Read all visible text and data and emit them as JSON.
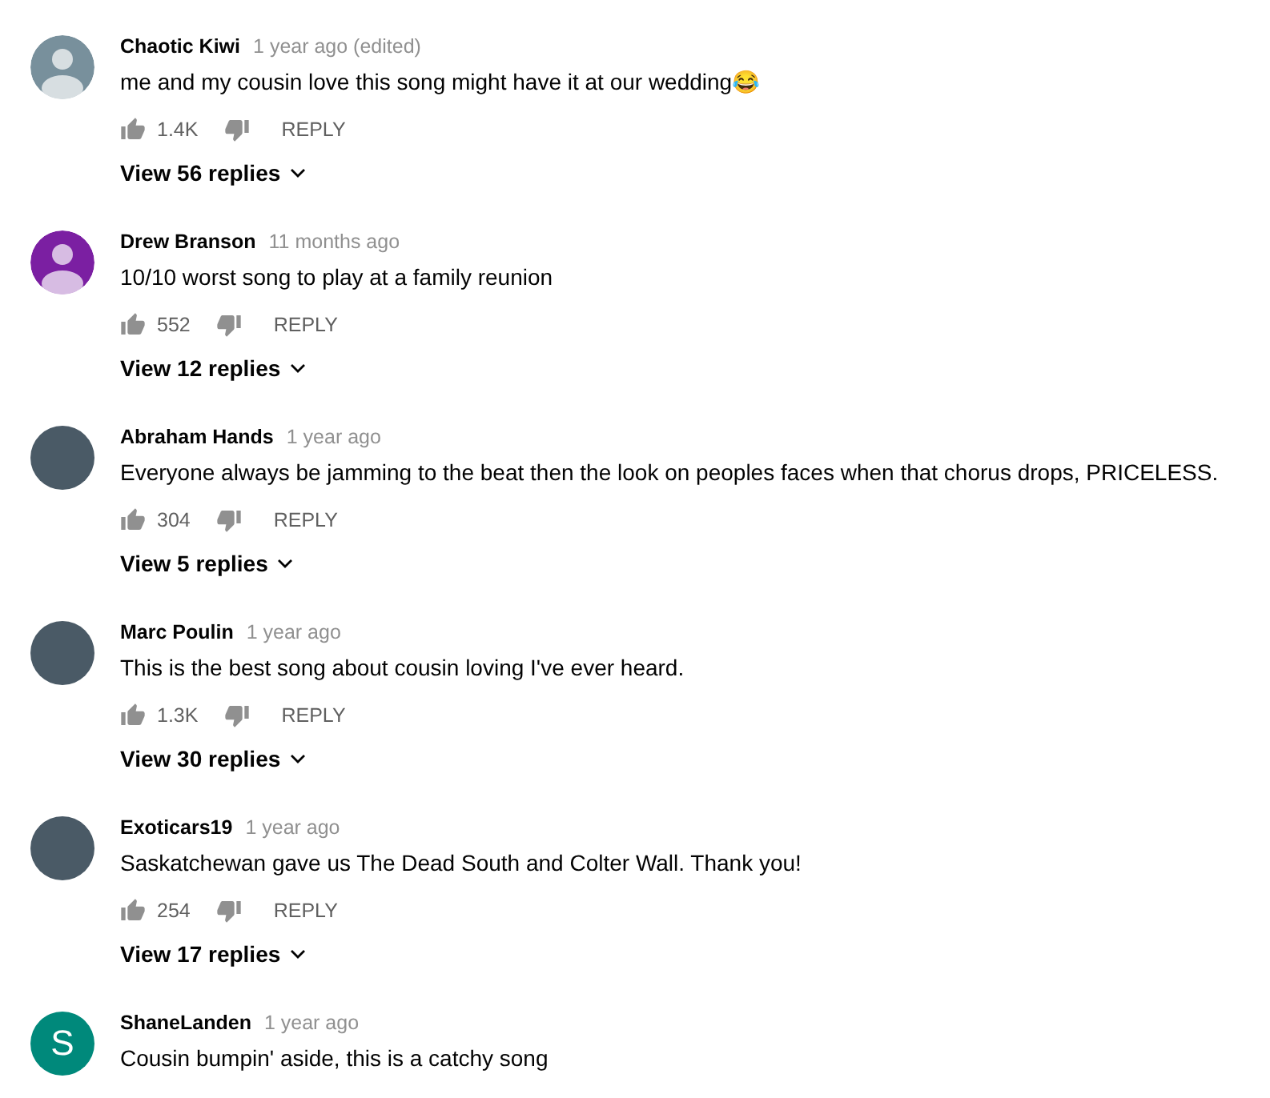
{
  "comments": [
    {
      "author": "Chaotic Kiwi",
      "time": "1 year ago (edited)",
      "text": "me and my cousin love this song might have it at our wedding😂",
      "likes": "1.4K",
      "reply": "REPLY",
      "replies": "View 56 replies",
      "avatar": {
        "kind": "silhouette",
        "color": "#78909c"
      }
    },
    {
      "author": "Drew Branson",
      "time": "11 months ago",
      "text": "10/10 worst song to play at a family reunion",
      "likes": "552",
      "reply": "REPLY",
      "replies": "View 12 replies",
      "avatar": {
        "kind": "silhouette",
        "color": "#7b1fa2"
      }
    },
    {
      "author": "Abraham Hands",
      "time": "1 year ago",
      "text": "Everyone always be jamming to the beat then the look on peoples faces when that chorus drops, PRICELESS.",
      "likes": "304",
      "reply": "REPLY",
      "replies": "View 5 replies",
      "avatar": {
        "kind": "photo"
      }
    },
    {
      "author": "Marc Poulin",
      "time": "1 year ago",
      "text": "This is the best song about cousin loving I've ever heard.",
      "likes": "1.3K",
      "reply": "REPLY",
      "replies": "View 30 replies",
      "avatar": {
        "kind": "photo"
      }
    },
    {
      "author": "Exoticars19",
      "time": "1 year ago",
      "text": "Saskatchewan gave us The Dead South and Colter Wall. Thank you!",
      "likes": "254",
      "reply": "REPLY",
      "replies": "View 17 replies",
      "avatar": {
        "kind": "photo"
      }
    },
    {
      "author": "ShaneLanden",
      "time": "1 year ago",
      "text": "Cousin bumpin' aside, this is a catchy song",
      "avatar": {
        "kind": "letter",
        "letter": "S",
        "color": "#00897b"
      }
    }
  ]
}
